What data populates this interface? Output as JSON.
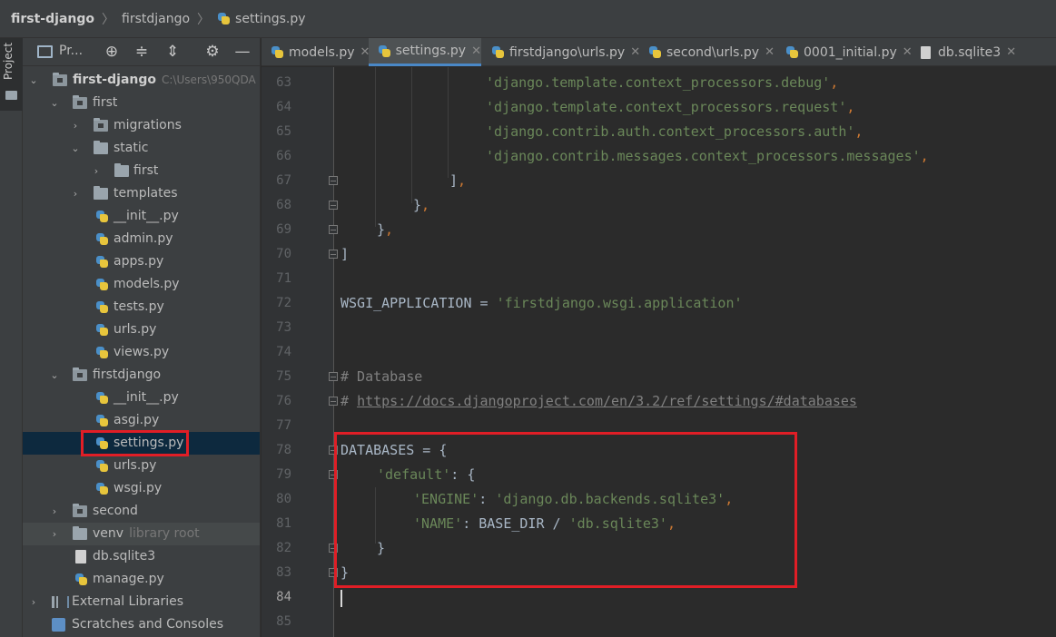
{
  "breadcrumb": {
    "project": "first-django",
    "folder": "firstdjango",
    "file": "settings.py"
  },
  "toolstrip": {
    "project_label": "Project"
  },
  "project_panel": {
    "title": "Pr...",
    "tree": [
      {
        "label": "first-django",
        "hint": "C:\\Users\\950QDA"
      },
      {
        "label": "first"
      },
      {
        "label": "migrations"
      },
      {
        "label": "static"
      },
      {
        "label": "first"
      },
      {
        "label": "templates"
      },
      {
        "label": "__init__.py"
      },
      {
        "label": "admin.py"
      },
      {
        "label": "apps.py"
      },
      {
        "label": "models.py"
      },
      {
        "label": "tests.py"
      },
      {
        "label": "urls.py"
      },
      {
        "label": "views.py"
      },
      {
        "label": "firstdjango"
      },
      {
        "label": "__init__.py"
      },
      {
        "label": "asgi.py"
      },
      {
        "label": "settings.py"
      },
      {
        "label": "urls.py"
      },
      {
        "label": "wsgi.py"
      },
      {
        "label": "second"
      },
      {
        "label": "venv",
        "hint": "library root"
      },
      {
        "label": "db.sqlite3"
      },
      {
        "label": "manage.py"
      },
      {
        "label": "External Libraries"
      },
      {
        "label": "Scratches and Consoles"
      }
    ]
  },
  "tabs": [
    {
      "label": "models.py"
    },
    {
      "label": "settings.py",
      "active": true
    },
    {
      "label": "firstdjango\\urls.py"
    },
    {
      "label": "second\\urls.py"
    },
    {
      "label": "0001_initial.py"
    },
    {
      "label": "db.sqlite3"
    }
  ],
  "editor": {
    "current_line": "84",
    "lines": [
      {
        "n": "63",
        "t": "'django.template.context_processors.debug'"
      },
      {
        "n": "64",
        "t": "'django.template.context_processors.request'"
      },
      {
        "n": "65",
        "t": "'django.contrib.auth.context_processors.auth'"
      },
      {
        "n": "66",
        "t": "'django.contrib.messages.context_processors.messages'"
      },
      {
        "n": "67",
        "t": "]"
      },
      {
        "n": "68",
        "t": "}"
      },
      {
        "n": "69",
        "t": "}"
      },
      {
        "n": "70",
        "t": "]"
      },
      {
        "n": "71",
        "t": ""
      },
      {
        "n": "72",
        "a": "WSGI_APPLICATION = ",
        "b": "'firstdjango.wsgi.application'"
      },
      {
        "n": "73",
        "t": ""
      },
      {
        "n": "74",
        "t": ""
      },
      {
        "n": "75",
        "t": "# Database"
      },
      {
        "n": "76",
        "a": "# ",
        "b": "https://docs.djangoproject.com/en/3.2/ref/settings/#databases"
      },
      {
        "n": "77",
        "t": ""
      },
      {
        "n": "78",
        "t": "DATABASES = {"
      },
      {
        "n": "79",
        "a": "'default'",
        "b": ": {"
      },
      {
        "n": "80",
        "a": "'ENGINE'",
        "b": ": ",
        "c": "'django.db.backends.sqlite3'"
      },
      {
        "n": "81",
        "a": "'NAME'",
        "b": ": BASE_DIR / ",
        "c": "'db.sqlite3'"
      },
      {
        "n": "82",
        "t": "}"
      },
      {
        "n": "83",
        "t": "}"
      },
      {
        "n": "84",
        "t": ""
      },
      {
        "n": "85",
        "t": ""
      }
    ]
  },
  "colors": {
    "string": "#6a8759",
    "keyword": "#cc7832",
    "comment": "#808080",
    "text": "#a9b7c6",
    "highlight_box": "#e01e26",
    "selection": "#0d293e"
  }
}
